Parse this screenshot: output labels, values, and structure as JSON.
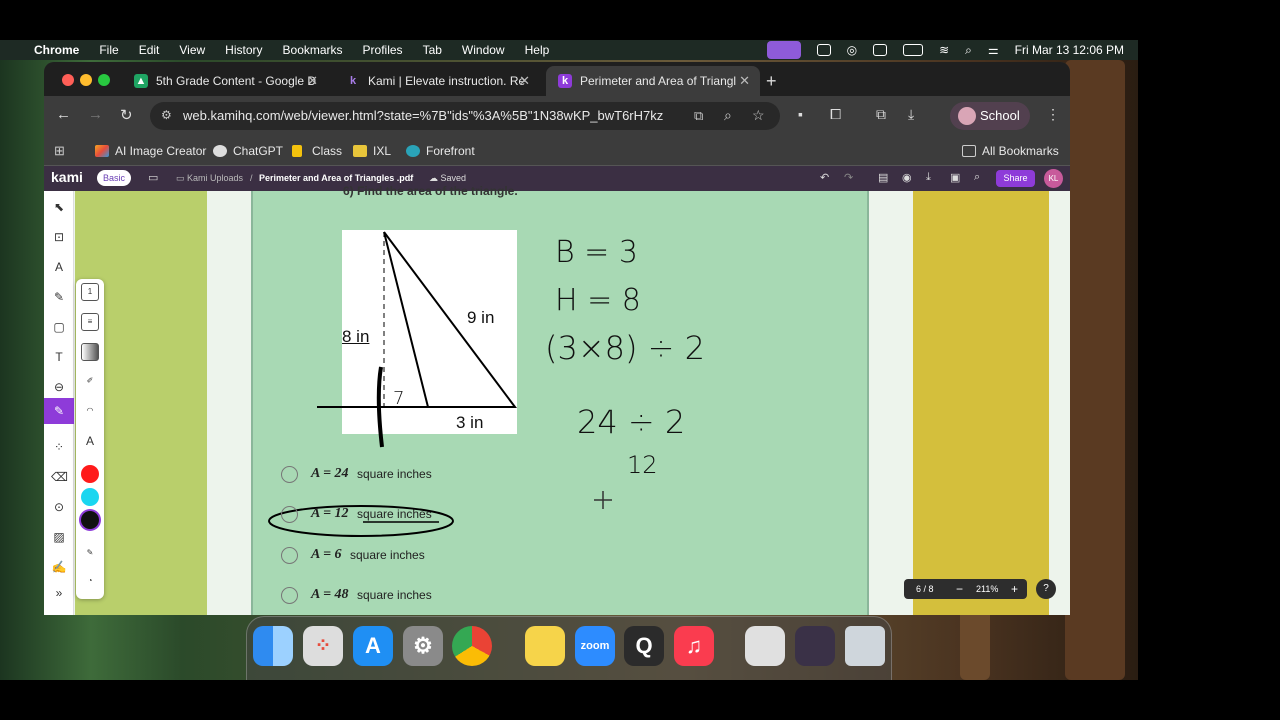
{
  "menubar": {
    "app": "Chrome",
    "items": [
      "File",
      "Edit",
      "View",
      "History",
      "Bookmarks",
      "Profiles",
      "Tab",
      "Window",
      "Help"
    ],
    "datetime": "Fri Mar 13  12:06 PM"
  },
  "browser": {
    "tabs": [
      {
        "label": "5th Grade Content - Google D"
      },
      {
        "label": "Kami | Elevate instruction. Re"
      },
      {
        "label": "Perimeter and Area of Triangl"
      }
    ],
    "url": "web.kamihq.com/web/viewer.html?state=%7B\"ids\"%3A%5B\"1N38wKP_bwT6rH7kz...",
    "profile_label": "School",
    "bookmarks": [
      "AI Image Creator",
      "ChatGPT",
      "Class",
      "IXL",
      "Forefront"
    ],
    "all_bookmarks": "All Bookmarks"
  },
  "kami": {
    "logo": "kami",
    "plan": "Basic",
    "folder": "Kami Uploads",
    "separator": "/",
    "file": "Perimeter and Area of Triangles .pdf",
    "status": "Saved",
    "share": "Share",
    "initials": "KL",
    "page": "6 / 8",
    "zoom": "211%",
    "help": "?",
    "stroke_width": "1"
  },
  "document": {
    "question": "6) Find the area of the triangle.",
    "figure": {
      "height_label": "8 in",
      "side_label": "9 in",
      "base_label": "3 in"
    },
    "options": [
      {
        "eq": "A = 24",
        "unit": "square inches"
      },
      {
        "eq": "A = 12",
        "unit": "square inches"
      },
      {
        "eq": "A = 6",
        "unit": "square inches"
      },
      {
        "eq": "A = 48",
        "unit": "square inches"
      }
    ],
    "handwriting": {
      "line1": "B = 3",
      "line2": "H = 8",
      "line3": "(3×8) ÷ 2",
      "line4": "24 ÷ 2",
      "line5": "12",
      "mark": "7"
    }
  },
  "colors": {
    "accent": "#8e3bd9",
    "swatch_red": "#ff1a1a",
    "swatch_cyan": "#1ad6f0",
    "swatch_black": "#111111",
    "page_green": "#a8d9b4"
  },
  "dock": {
    "zoom_label": "zoom",
    "apps": [
      "finder-icon",
      "launchpad-icon",
      "app-store-icon",
      "system-settings-icon",
      "chrome-icon",
      "notes-icon",
      "zoom-icon",
      "quicktime-icon",
      "music-icon",
      "trash-icon"
    ]
  }
}
